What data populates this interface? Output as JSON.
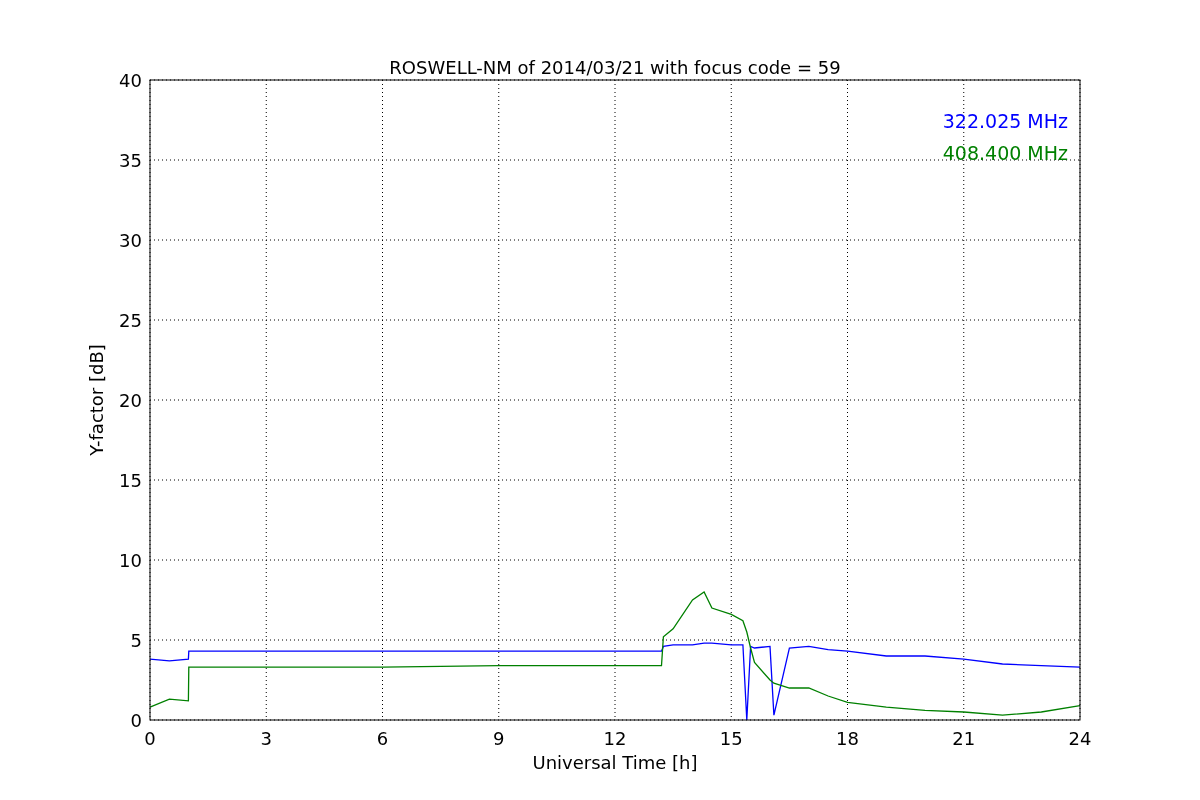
{
  "chart_data": {
    "type": "line",
    "title": "ROSWELL-NM of 2014/03/21 with focus code = 59",
    "xlabel": "Universal Time [h]",
    "ylabel": "Y-factor [dB]",
    "x": [
      0,
      0.5,
      0.99,
      1,
      3,
      6,
      9,
      12,
      13.2,
      13.25,
      13.5,
      14,
      14.3,
      14.5,
      15,
      15.3,
      15.4,
      15.5,
      15.6,
      16,
      16.1,
      16.5,
      17,
      17.5,
      18,
      19,
      20,
      21,
      22,
      23,
      24
    ],
    "series": [
      {
        "name": "322.025 MHz",
        "color": "#0000ff",
        "values": [
          3.8,
          3.7,
          3.8,
          4.3,
          4.3,
          4.3,
          4.3,
          4.3,
          4.3,
          4.6,
          4.7,
          4.7,
          4.8,
          4.8,
          4.7,
          4.7,
          0,
          4.6,
          4.5,
          4.6,
          0.3,
          4.5,
          4.6,
          4.4,
          4.3,
          4.0,
          4.0,
          3.8,
          3.5,
          3.4,
          3.3
        ]
      },
      {
        "name": "408.400 MHz",
        "color": "#008000",
        "values": [
          0.8,
          1.3,
          1.2,
          3.3,
          3.3,
          3.3,
          3.4,
          3.4,
          3.4,
          5.2,
          5.7,
          7.5,
          8.0,
          7.0,
          6.6,
          6.2,
          5.5,
          4.5,
          3.6,
          2.5,
          2.3,
          2.0,
          2.0,
          1.5,
          1.1,
          0.8,
          0.6,
          0.5,
          0.3,
          0.5,
          0.9
        ]
      }
    ],
    "grid": true,
    "xlim": [
      0,
      24
    ],
    "ylim": [
      0,
      40
    ],
    "xticks": [
      0,
      3,
      6,
      9,
      12,
      15,
      18,
      21,
      24
    ],
    "yticks": [
      0,
      5,
      10,
      15,
      20,
      25,
      30,
      35,
      40
    ]
  }
}
